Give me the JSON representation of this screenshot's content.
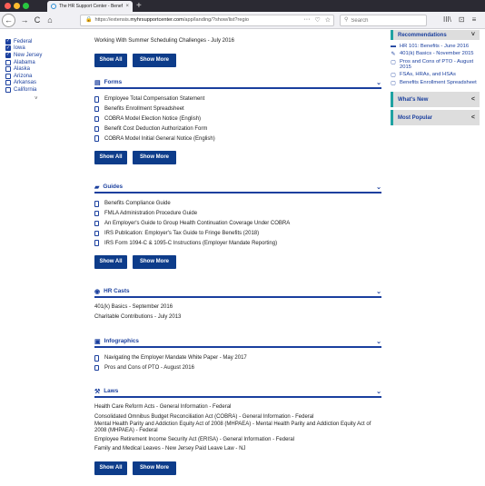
{
  "browser": {
    "tab_title": "The HR Support Center - Benef",
    "tab_close": "×",
    "new_tab": "+",
    "url_prefix": "https://extensis.",
    "url_host": "myhrsupportcenter.com",
    "url_rest": "/app/landing/?show/list?regio",
    "url_icons": [
      "···",
      "♡",
      "☆"
    ],
    "search_placeholder": "Search",
    "nav": {
      "back": "←",
      "forward": "→",
      "reload": "C",
      "home": "⌂"
    },
    "tools": [
      "III\\",
      "⊡",
      "≡"
    ]
  },
  "states": [
    {
      "label": "Federal",
      "checked": true
    },
    {
      "label": "Iowa",
      "checked": true
    },
    {
      "label": "New Jersey",
      "checked": true
    },
    {
      "label": "Alabama",
      "checked": false
    },
    {
      "label": "Alaska",
      "checked": false
    },
    {
      "label": "Arizona",
      "checked": false
    },
    {
      "label": "Arkansas",
      "checked": false
    },
    {
      "label": "California",
      "checked": false
    }
  ],
  "states_more": "˅",
  "top_item": "Working With Summer Scheduling Challenges - July 2016",
  "buttons": {
    "show_all": "Show All",
    "show_more": "Show More"
  },
  "sections": {
    "forms": {
      "title": "Forms",
      "items": [
        "Employee Total Compensation Statement",
        "Benefits Enrollment Spreadsheet",
        "COBRA Model Election Notice (English)",
        "Benefit Cost Deduction Authorization Form",
        "COBRA Model Initial General Notice (English)"
      ]
    },
    "guides": {
      "title": "Guides",
      "items": [
        "Benefits Compliance Guide",
        "FMLA Administration Procedure Guide",
        "An Employer's Guide to Group Health Continuation Coverage Under COBRA",
        "IRS Publication: Employer's Tax Guide to Fringe Benefits (2018)",
        "IRS Form 1094-C & 1095-C Instructions (Employer Mandate Reporting)"
      ]
    },
    "hrcasts": {
      "title": "HR Casts",
      "items": [
        "401(k) Basics - September 2016",
        "Charitable Contributions - July 2013"
      ]
    },
    "infographics": {
      "title": "Infographics",
      "items": [
        "Navigating the Employer Mandate White Paper - May 2017",
        "Pros and Cons of PTO - August 2016"
      ]
    },
    "laws": {
      "title": "Laws",
      "items": [
        "Health Care Reform Acts - General Information - Federal",
        "Consolidated Omnibus Budget Reconciliation Act (COBRA) - General Information - Federal",
        "Mental Health Parity and Addiction Equity Act of 2008 (MHPAEA) - Mental Health Parity and Addiction Equity Act of 2008 (MHPAEA) - Federal",
        "Employee Retirement Income Security Act (ERISA) - General Information - Federal",
        "Family and Medical Leaves - New Jersey Paid Leave Law - NJ"
      ]
    }
  },
  "recommendations": {
    "title": "Recommendations",
    "chevron": "˅",
    "items": [
      {
        "icon": "video-icon",
        "glyph": "▬",
        "label": "HR 101: Benefits - June 2016"
      },
      {
        "icon": "pencil-icon",
        "glyph": "✎",
        "label": "401(k) Basics - November 2015"
      },
      {
        "icon": "document-icon",
        "glyph": "▢",
        "label": "Pros and Cons of PTO - August 2015"
      },
      {
        "icon": "document-icon",
        "glyph": "▢",
        "label": "FSAs, HRAs, and HSAs"
      },
      {
        "icon": "document-icon",
        "glyph": "▢",
        "label": "Benefits Enrollment Spreadsheet"
      }
    ]
  },
  "panels": [
    {
      "label": "What's New",
      "chevron": "<"
    },
    {
      "label": "Most Popular",
      "chevron": "<"
    }
  ],
  "colors": {
    "accent": "#1a3f9e",
    "button": "#0d3c8a",
    "teal": "#1fa2a2"
  }
}
